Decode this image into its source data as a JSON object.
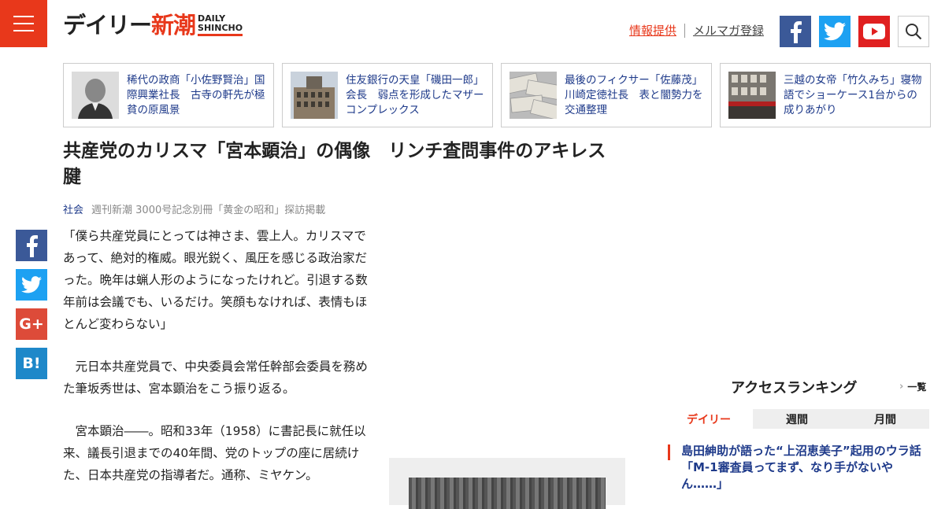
{
  "logo": {
    "jp_main": "デイリー",
    "jp_accent": "新潮",
    "en_line1": "DAILY",
    "en_line2": "SHINCHO"
  },
  "header": {
    "info_link": "情報提供",
    "newsletter_link": "メルマガ登録",
    "icons": [
      "menu-icon",
      "facebook-icon",
      "twitter-icon",
      "youtube-icon",
      "search-icon"
    ],
    "colors": {
      "accent": "#e8381b",
      "facebook": "#3b5998",
      "twitter": "#1da1f2",
      "youtube": "#e02020",
      "link": "#1e3a8a"
    }
  },
  "related": [
    {
      "text": "稀代の政商「小佐野賢治」国際興業社長　古寺の軒先が極貧の原風景"
    },
    {
      "text": "住友銀行の天皇「磯田一郎」会長　弱点を形成したマザーコンプレックス"
    },
    {
      "text": "最後のフィクサー「佐藤茂」川崎定徳社長　表と闇勢力を交通整理"
    },
    {
      "text": "三越の女帝「竹久みち」寝物語でショーケース1台からの成りあがり"
    }
  ],
  "article": {
    "title": "共産党のカリスマ「宮本顕治」の偶像　リンチ査問事件のアキレス腱",
    "category": "社会",
    "source": "週刊新潮 3000号記念別冊「黄金の昭和」探訪掲載",
    "paragraphs": [
      "「僕ら共産党員にとっては神さま、雲上人。カリスマであって、絶対的権威。眼光鋭く、風圧を感じる政治家だった。晩年は蝋人形のようになったけれど。引退する数年前は会議でも、いるだけ。笑顔もなければ、表情もほとんど変わらない」",
      "元日本共産党員で、中央委員会常任幹部会委員を務めた筆坂秀世は、宮本顕治をこう振り返る。",
      "宮本顕治――。昭和33年（1958）に書記長に就任以来、議長引退までの40年間、党のトップの座に居続けた、日本共産党の指導者だ。通称、ミヤケン。"
    ]
  },
  "share": {
    "icons": [
      "facebook-icon",
      "twitter-icon",
      "google-plus-icon",
      "hatena-bookmark-icon"
    ],
    "google_plus_label": "G+",
    "hatena_label": "B!"
  },
  "ranking": {
    "title": "アクセスランキング",
    "more": "一覧",
    "tabs": [
      "デイリー",
      "週間",
      "月間"
    ],
    "active_tab": "デイリー",
    "items": [
      {
        "text": "島田紳助が語った“上沼恵美子”起用のウラ話　「M-1審査員ってまず、なり手がないやん……」"
      }
    ]
  }
}
